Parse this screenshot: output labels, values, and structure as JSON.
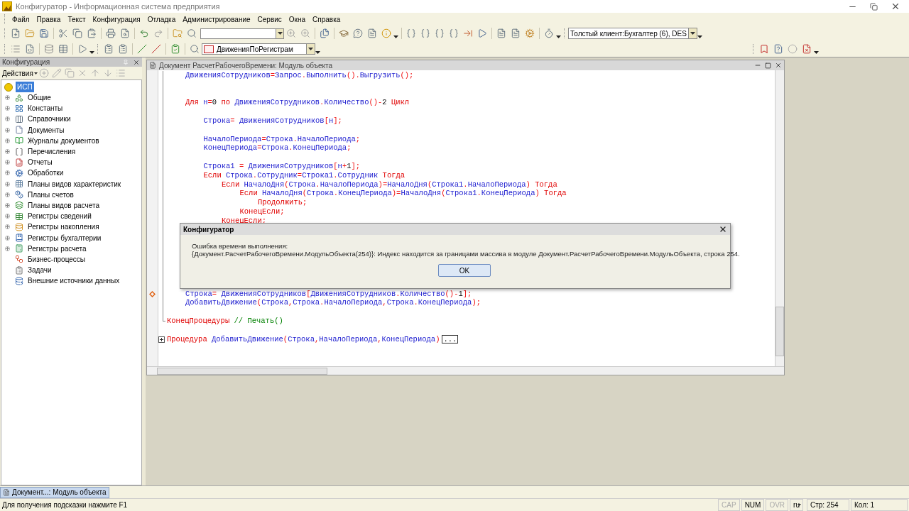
{
  "window": {
    "title": "Конфигуратор - Информационная система предприятия"
  },
  "menu": [
    "Файл",
    "Правка",
    "Текст",
    "Конфигурация",
    "Отладка",
    "Администрирование",
    "Сервис",
    "Окна",
    "Справка"
  ],
  "toolbar": {
    "client_combo": "Толстый клиент:Бухгалтер (6), DES",
    "procedure_combo": "ДвиженияПоРегистрам"
  },
  "config_panel": {
    "title": "Конфигурация",
    "actions": "Действия",
    "root": {
      "label": "ИСП",
      "selected": true,
      "children": [
        {
          "label": "Общие",
          "expandable": true,
          "selected": false
        },
        {
          "label": "Константы",
          "expandable": true,
          "selected": false
        },
        {
          "label": "Справочники",
          "expandable": true,
          "selected": false
        },
        {
          "label": "Документы",
          "expandable": true,
          "selected": false
        },
        {
          "label": "Журналы документов",
          "expandable": true,
          "selected": false
        },
        {
          "label": "Перечисления",
          "expandable": true,
          "selected": false
        },
        {
          "label": "Отчеты",
          "expandable": true,
          "selected": false
        },
        {
          "label": "Обработки",
          "expandable": true,
          "selected": false
        },
        {
          "label": "Планы видов характеристик",
          "expandable": true,
          "selected": false
        },
        {
          "label": "Планы счетов",
          "expandable": true,
          "selected": false
        },
        {
          "label": "Планы видов расчета",
          "expandable": true,
          "selected": false
        },
        {
          "label": "Регистры сведений",
          "expandable": true,
          "selected": false
        },
        {
          "label": "Регистры накопления",
          "expandable": true,
          "selected": false
        },
        {
          "label": "Регистры бухгалтерии",
          "expandable": true,
          "selected": false
        },
        {
          "label": "Регистры расчета",
          "expandable": true,
          "selected": false
        },
        {
          "label": "Бизнес-процессы",
          "expandable": false,
          "selected": false
        },
        {
          "label": "Задачи",
          "expandable": false,
          "selected": false
        },
        {
          "label": "Внешние источники данных",
          "expandable": false,
          "selected": false
        }
      ]
    }
  },
  "editor": {
    "title": "Документ РасчетРабочегоВремени: Модуль объекта",
    "procedure_body_top": [
      {
        "kind": "code",
        "tokens": [
          {
            "kind": "name",
            "text": "ДвиженияСотрудников"
          },
          {
            "kind": "op",
            "text": "="
          },
          {
            "kind": "name",
            "text": "Запрос"
          },
          {
            "kind": "op",
            "text": "."
          },
          {
            "kind": "name",
            "text": "Выполнить"
          },
          {
            "kind": "op",
            "text": "()."
          },
          {
            "kind": "name",
            "text": "Выгрузить"
          },
          {
            "kind": "op",
            "text": "();"
          }
        ]
      },
      {
        "kind": "blank"
      },
      {
        "kind": "blank"
      },
      {
        "kind": "code",
        "tokens": [
          {
            "kind": "keyword",
            "text": "Для "
          },
          {
            "kind": "name",
            "text": "н"
          },
          {
            "kind": "op",
            "text": "="
          },
          {
            "kind": "number",
            "text": "0"
          },
          {
            "kind": "keyword",
            "text": " по "
          },
          {
            "kind": "name",
            "text": "ДвиженияСотрудников"
          },
          {
            "kind": "op",
            "text": "."
          },
          {
            "kind": "name",
            "text": "Количество"
          },
          {
            "kind": "op",
            "text": "()-"
          },
          {
            "kind": "number",
            "text": "2"
          },
          {
            "kind": "keyword",
            "text": " Цикл"
          }
        ],
        "children": [
          {
            "kind": "blank"
          },
          {
            "kind": "code",
            "tokens": [
              {
                "kind": "name",
                "text": "Строка"
              },
              {
                "kind": "op",
                "text": "= "
              },
              {
                "kind": "name",
                "text": "ДвиженияСотрудников"
              },
              {
                "kind": "op",
                "text": "["
              },
              {
                "kind": "name",
                "text": "н"
              },
              {
                "kind": "op",
                "text": "];"
              }
            ]
          },
          {
            "kind": "blank"
          },
          {
            "kind": "code",
            "tokens": [
              {
                "kind": "name",
                "text": "НачалоПериода"
              },
              {
                "kind": "op",
                "text": "="
              },
              {
                "kind": "name",
                "text": "Строка"
              },
              {
                "kind": "op",
                "text": "."
              },
              {
                "kind": "name",
                "text": "НачалоПериода"
              },
              {
                "kind": "op",
                "text": ";"
              }
            ]
          },
          {
            "kind": "code",
            "tokens": [
              {
                "kind": "name",
                "text": "КонецПериода"
              },
              {
                "kind": "op",
                "text": "="
              },
              {
                "kind": "name",
                "text": "Строка"
              },
              {
                "kind": "op",
                "text": "."
              },
              {
                "kind": "name",
                "text": "КонецПериода"
              },
              {
                "kind": "op",
                "text": ";"
              }
            ]
          },
          {
            "kind": "blank"
          },
          {
            "kind": "code",
            "tokens": [
              {
                "kind": "name",
                "text": "Строка1 "
              },
              {
                "kind": "op",
                "text": "= "
              },
              {
                "kind": "name",
                "text": "ДвиженияСотрудников"
              },
              {
                "kind": "op",
                "text": "["
              },
              {
                "kind": "name",
                "text": "н"
              },
              {
                "kind": "op",
                "text": "+"
              },
              {
                "kind": "number",
                "text": "1"
              },
              {
                "kind": "op",
                "text": "];"
              }
            ]
          },
          {
            "kind": "code",
            "tokens": [
              {
                "kind": "keyword",
                "text": "Если "
              },
              {
                "kind": "name",
                "text": "Строка"
              },
              {
                "kind": "op",
                "text": "."
              },
              {
                "kind": "name",
                "text": "Сотрудник"
              },
              {
                "kind": "op",
                "text": "="
              },
              {
                "kind": "name",
                "text": "Строка1"
              },
              {
                "kind": "op",
                "text": "."
              },
              {
                "kind": "name",
                "text": "Сотрудник"
              },
              {
                "kind": "keyword",
                "text": " Тогда"
              }
            ],
            "children": [
              {
                "kind": "code",
                "tokens": [
                  {
                    "kind": "keyword",
                    "text": "Если "
                  },
                  {
                    "kind": "name",
                    "text": "НачалоДня"
                  },
                  {
                    "kind": "op",
                    "text": "("
                  },
                  {
                    "kind": "name",
                    "text": "Строка"
                  },
                  {
                    "kind": "op",
                    "text": "."
                  },
                  {
                    "kind": "name",
                    "text": "НачалоПериода"
                  },
                  {
                    "kind": "op",
                    "text": ")="
                  },
                  {
                    "kind": "name",
                    "text": "НачалоДня"
                  },
                  {
                    "kind": "op",
                    "text": "("
                  },
                  {
                    "kind": "name",
                    "text": "Строка1"
                  },
                  {
                    "kind": "op",
                    "text": "."
                  },
                  {
                    "kind": "name",
                    "text": "НачалоПериода"
                  },
                  {
                    "kind": "op",
                    "text": ")"
                  },
                  {
                    "kind": "keyword",
                    "text": " Тогда"
                  }
                ],
                "children": [
                  {
                    "kind": "code",
                    "tokens": [
                      {
                        "kind": "keyword",
                        "text": "Если "
                      },
                      {
                        "kind": "name",
                        "text": "НачалоДня"
                      },
                      {
                        "kind": "op",
                        "text": "("
                      },
                      {
                        "kind": "name",
                        "text": "Строка"
                      },
                      {
                        "kind": "op",
                        "text": "."
                      },
                      {
                        "kind": "name",
                        "text": "КонецПериода"
                      },
                      {
                        "kind": "op",
                        "text": ")="
                      },
                      {
                        "kind": "name",
                        "text": "НачалоДня"
                      },
                      {
                        "kind": "op",
                        "text": "("
                      },
                      {
                        "kind": "name",
                        "text": "Строка1"
                      },
                      {
                        "kind": "op",
                        "text": "."
                      },
                      {
                        "kind": "name",
                        "text": "КонецПериода"
                      },
                      {
                        "kind": "op",
                        "text": ")"
                      },
                      {
                        "kind": "keyword",
                        "text": " Тогда"
                      }
                    ],
                    "children": [
                      {
                        "kind": "code",
                        "tokens": [
                          {
                            "kind": "keyword",
                            "text": "Продолжить"
                          },
                          {
                            "kind": "op",
                            "text": ";"
                          }
                        ]
                      }
                    ]
                  },
                  {
                    "kind": "code",
                    "tokens": [
                      {
                        "kind": "keyword",
                        "text": "КонецЕсли"
                      },
                      {
                        "kind": "op",
                        "text": ";"
                      }
                    ]
                  }
                ]
              },
              {
                "kind": "code",
                "tokens": [
                  {
                    "kind": "keyword",
                    "text": "КонецЕсли"
                  },
                  {
                    "kind": "op",
                    "text": ";"
                  }
                ]
              }
            ]
          }
        ]
      }
    ],
    "procedure_body_bottom": [
      {
        "kind": "code",
        "current": true,
        "tokens": [
          {
            "kind": "name",
            "text": "Строка"
          },
          {
            "kind": "op",
            "text": "= "
          },
          {
            "kind": "name",
            "text": "ДвиженияСотрудников"
          },
          {
            "kind": "op",
            "text": "["
          },
          {
            "kind": "name",
            "text": "ДвиженияСотрудников"
          },
          {
            "kind": "op",
            "text": "."
          },
          {
            "kind": "name",
            "text": "Количество"
          },
          {
            "kind": "op",
            "text": "()-"
          },
          {
            "kind": "number",
            "text": "1"
          },
          {
            "kind": "op",
            "text": "];"
          }
        ]
      },
      {
        "kind": "code",
        "current": false,
        "tokens": [
          {
            "kind": "name",
            "text": "ДобавитьДвижение"
          },
          {
            "kind": "op",
            "text": "("
          },
          {
            "kind": "name",
            "text": "Строка"
          },
          {
            "kind": "op",
            "text": ","
          },
          {
            "kind": "name",
            "text": "Строка"
          },
          {
            "kind": "op",
            "text": "."
          },
          {
            "kind": "name",
            "text": "НачалоПериода"
          },
          {
            "kind": "op",
            "text": ","
          },
          {
            "kind": "name",
            "text": "Строка"
          },
          {
            "kind": "op",
            "text": "."
          },
          {
            "kind": "name",
            "text": "КонецПериода"
          },
          {
            "kind": "op",
            "text": ");"
          }
        ]
      }
    ],
    "following": [
      {
        "kind": "end",
        "tokens": [
          {
            "kind": "keyword",
            "text": "КонецПроцедуры "
          },
          {
            "kind": "comment",
            "text": "// Печать()"
          }
        ]
      },
      {
        "kind": "blank"
      },
      {
        "kind": "collapsed",
        "ellipsis": "...",
        "tokens": [
          {
            "kind": "keyword",
            "text": "Процедура "
          },
          {
            "kind": "name",
            "text": "ДобавитьДвижение"
          },
          {
            "kind": "op",
            "text": "("
          },
          {
            "kind": "name",
            "text": "Строка"
          },
          {
            "kind": "op",
            "text": ","
          },
          {
            "kind": "name",
            "text": "НачалоПериода"
          },
          {
            "kind": "op",
            "text": ","
          },
          {
            "kind": "name",
            "text": "КонецПериода"
          },
          {
            "kind": "op",
            "text": ")"
          }
        ]
      }
    ]
  },
  "dialog": {
    "title": "Конфигуратор",
    "heading": "Ошибка времени выполнения:",
    "message": "{Документ.РасчетРабочегоВремени.МодульОбъекта(254)}: Индекс находится за границами массива в модуле Документ.РасчетРабочегоВремени.МодульОбъекта, строка 254.",
    "button": "OK"
  },
  "taskbar": [
    {
      "label": "Документ...: Модуль объекта",
      "selected": true
    }
  ],
  "status_bar": {
    "hint": "Для получения подсказки нажмите F1",
    "indicators": [
      {
        "label": "CAP",
        "on": false
      },
      {
        "label": "NUM",
        "on": true
      },
      {
        "label": "OVR",
        "on": false
      }
    ],
    "language": "ru",
    "line": "Стр: 254",
    "column": "Кол: 1"
  }
}
